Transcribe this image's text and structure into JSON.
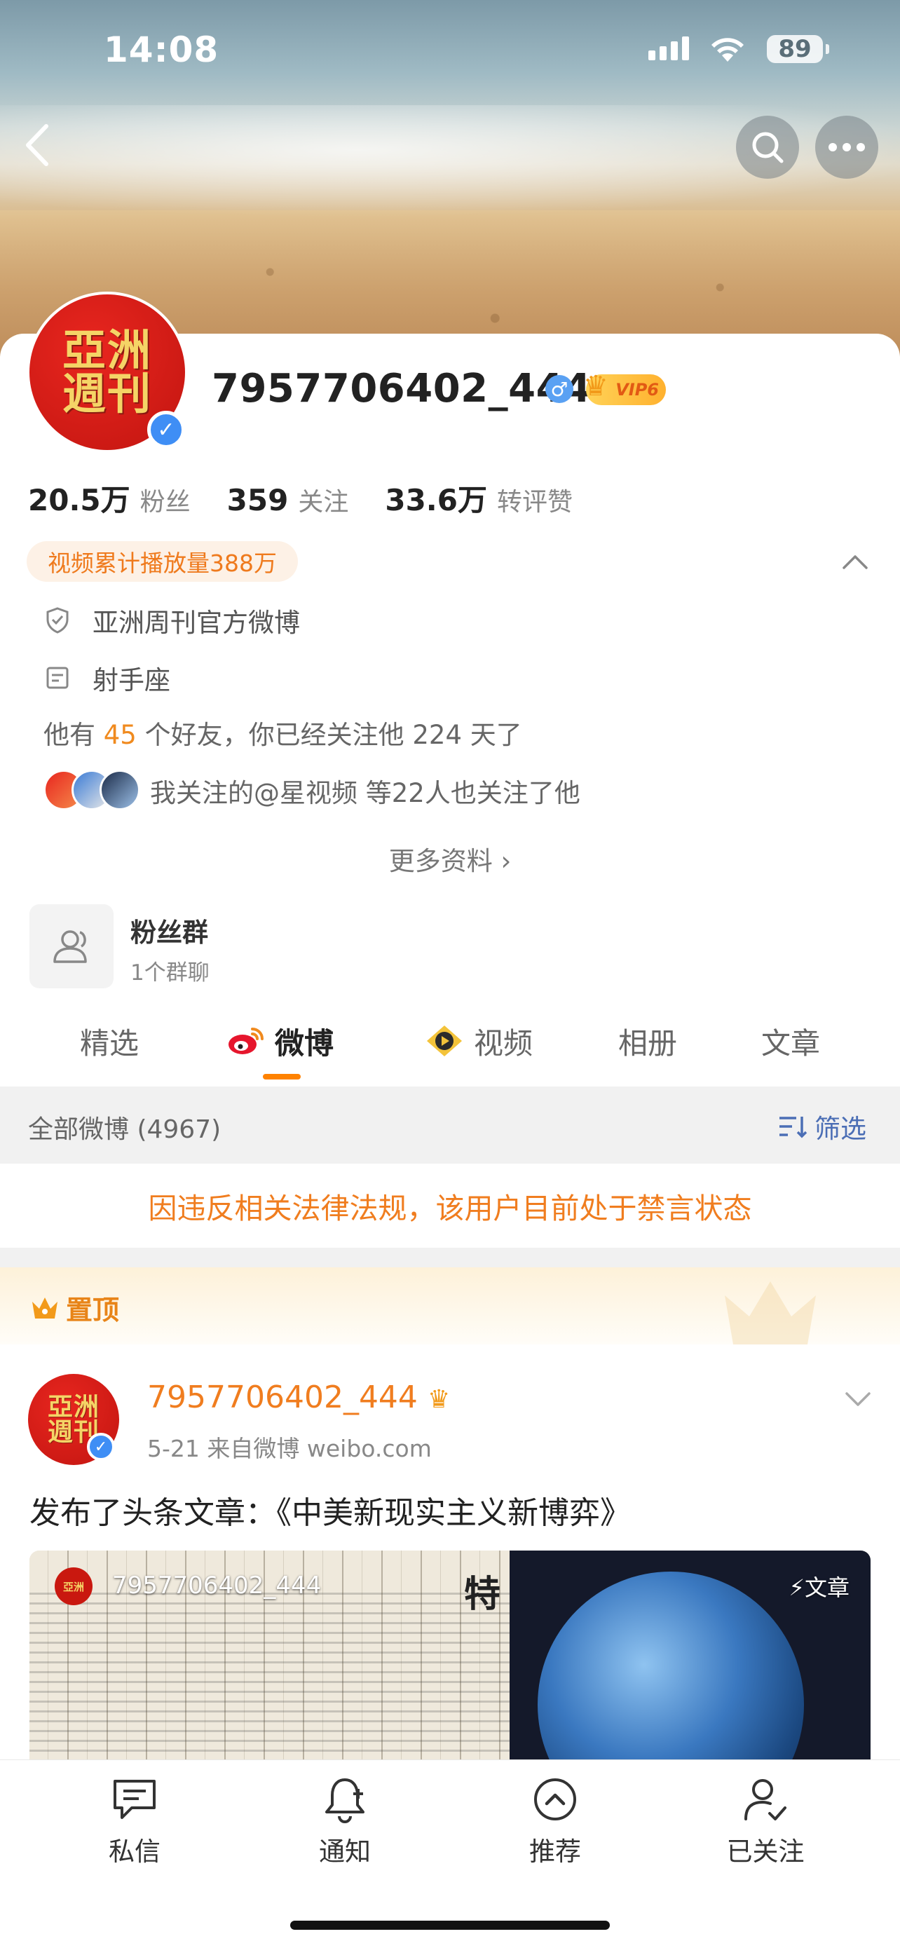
{
  "status": {
    "time": "14:08",
    "battery": "89"
  },
  "profile": {
    "avatar_text_line1": "亞洲",
    "avatar_text_line2": "週刊",
    "username": "7957706402_444",
    "vip_label": "VIP6",
    "stats": [
      {
        "value": "20.5万",
        "label": "粉丝"
      },
      {
        "value": "359",
        "label": "关注"
      },
      {
        "value": "33.6万",
        "label": "转评赞"
      }
    ],
    "play_tag": "视频累计播放量388万",
    "verified_desc": "亚洲周刊官方微博",
    "zodiac": "射手座",
    "friends_prefix": "他有",
    "friends_count": "45",
    "friends_suffix": "个好友，你已经关注他 224 天了",
    "mutual_text": "我关注的@星视频  等22人也关注了他",
    "more_info": "更多资料 ›"
  },
  "fan_group": {
    "title": "粉丝群",
    "subtitle": "1个群聊"
  },
  "tabs": [
    {
      "label": "精选"
    },
    {
      "label": "微博"
    },
    {
      "label": "视频"
    },
    {
      "label": "相册"
    },
    {
      "label": "文章"
    }
  ],
  "filter": {
    "all_label": "全部微博 (4967)",
    "filter_label": "筛选"
  },
  "ban_notice": "因违反相关法律法规，该用户目前处于禁言状态",
  "pinned_label": "置顶",
  "post": {
    "author": "7957706402_444",
    "meta": "5-21  来自微博 weibo.com",
    "text": "发布了头条文章：《中美新现实主义新博弈》",
    "card_author": "7957706402_444",
    "card_tag": "⚡文章",
    "card_big_char": "特"
  },
  "tabbar": [
    {
      "label": "私信",
      "icon": "message-icon"
    },
    {
      "label": "通知",
      "icon": "bell-icon"
    },
    {
      "label": "推荐",
      "icon": "recommend-icon"
    },
    {
      "label": "已关注",
      "icon": "followed-user-icon"
    }
  ],
  "colors": {
    "accent": "#ff8200",
    "orange_text": "#f07d1f",
    "link_blue": "#4b6eb5",
    "verified_blue": "#3f8ef5"
  }
}
